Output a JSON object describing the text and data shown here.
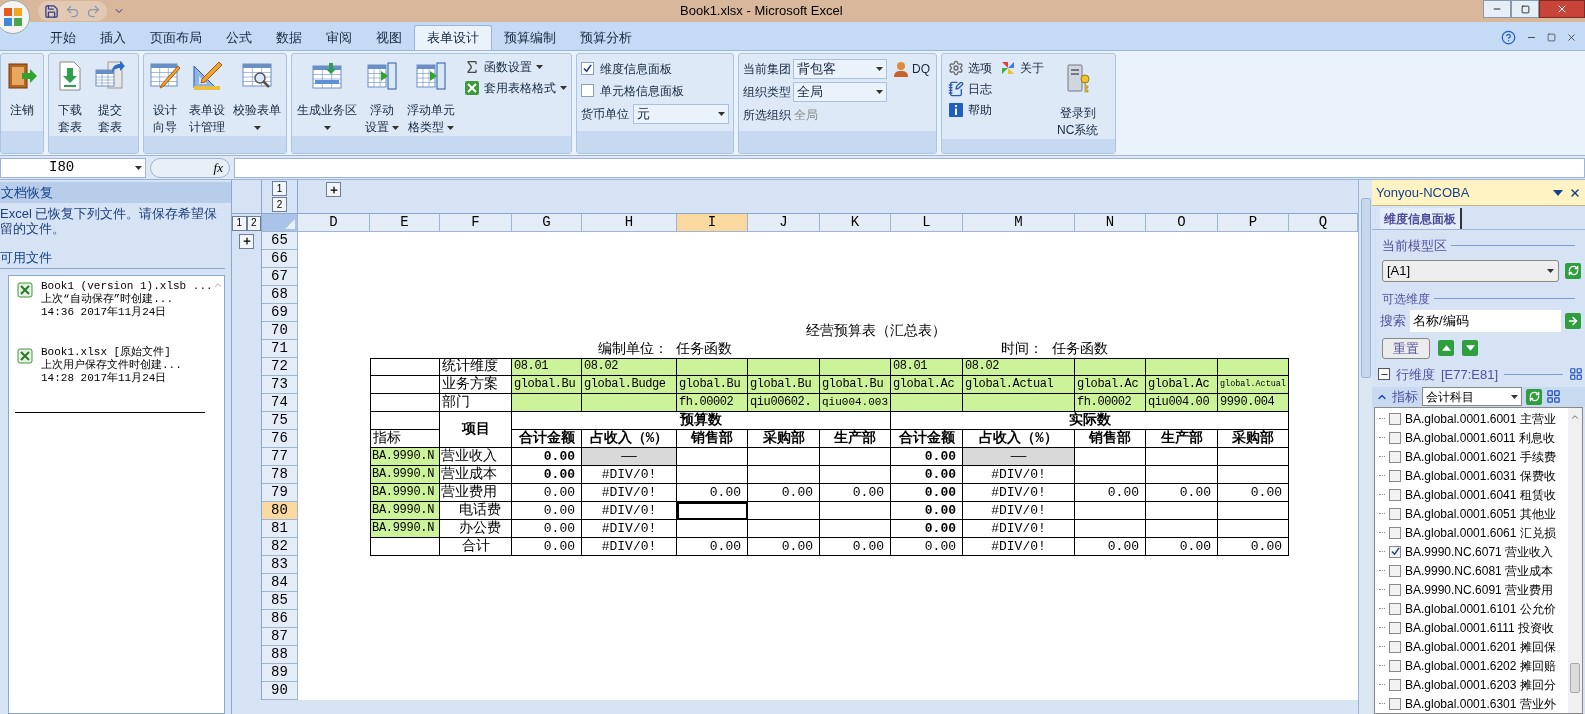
{
  "window": {
    "title": "Book1.xlsx - Microsoft Excel"
  },
  "ribbon_tabs": [
    {
      "label": "开始",
      "selected": false
    },
    {
      "label": "插入",
      "selected": false
    },
    {
      "label": "页面布局",
      "selected": false
    },
    {
      "label": "公式",
      "selected": false
    },
    {
      "label": "数据",
      "selected": false
    },
    {
      "label": "审阅",
      "selected": false
    },
    {
      "label": "视图",
      "selected": false
    },
    {
      "label": "表单设计",
      "selected": true
    },
    {
      "label": "预算编制",
      "selected": false
    },
    {
      "label": "预算分析",
      "selected": false
    }
  ],
  "ribbon_groups": [
    {
      "kind": "buttons",
      "buttons": [
        {
          "lines": [
            "注销"
          ],
          "dropdown": false
        }
      ]
    },
    {
      "kind": "buttons",
      "buttons": [
        {
          "lines": [
            "下载",
            "套表"
          ],
          "dropdown": false
        },
        {
          "lines": [
            "提交",
            "套表"
          ],
          "dropdown": false
        }
      ]
    },
    {
      "kind": "buttons",
      "buttons": [
        {
          "lines": [
            "设计",
            "向导"
          ],
          "dropdown": false
        },
        {
          "lines": [
            "表单设",
            "计管理"
          ],
          "dropdown": false
        },
        {
          "lines": [
            "校验表单"
          ],
          "dropdown": true
        }
      ]
    },
    {
      "kind": "buttons",
      "buttons": [
        {
          "lines": [
            "生成业务区"
          ],
          "dropdown": true
        },
        {
          "lines": [
            "浮动",
            "设置"
          ],
          "dropdown": true
        },
        {
          "lines": [
            "浮动单元",
            "格类型"
          ],
          "dropdown": true
        }
      ],
      "small_buttons": [
        {
          "label": "函数设置",
          "dropdown": true
        },
        {
          "label": "套用表格格式",
          "dropdown": true
        }
      ]
    },
    {
      "kind": "panels",
      "toggles": [
        {
          "label": "维度信息面板",
          "checked": true
        },
        {
          "label": "单元格信息面板",
          "checked": false
        }
      ],
      "currency": {
        "label": "货币单位",
        "value": "元"
      }
    },
    {
      "kind": "organization",
      "fields": [
        {
          "label": "当前集团",
          "value": "背包客",
          "kind": "select"
        },
        {
          "label": "组织类型",
          "value": "全局",
          "kind": "select"
        },
        {
          "label": "所选组织",
          "value": "全局",
          "kind": "readonly"
        }
      ],
      "user": "DQ"
    },
    {
      "kind": "system",
      "small_buttons": [
        {
          "label": "选项",
          "dropdown": false
        },
        {
          "label": "关于",
          "dropdown": false
        },
        {
          "label": "日志",
          "dropdown": false
        },
        {
          "label": "帮助",
          "dropdown": false
        }
      ],
      "buttons": [
        {
          "lines": [
            "登录到",
            "NC系统"
          ],
          "dropdown": false
        }
      ]
    }
  ],
  "formula_bar": {
    "name_box": "I80",
    "function_label": "fx"
  },
  "recovery_pane": {
    "title": "文档恢复",
    "message": "Excel 已恢复下列文件。请保存希望保留的文件。",
    "files_heading": "可用文件",
    "files": [
      {
        "name": "Book1 (version 1).xlsb ...",
        "note": "上次“自动保存”时创建...",
        "time": "14:36 2017年11月24日"
      },
      {
        "name": "Book1.xlsx  [原始文件]",
        "note": "上次用户保存文件时创建...",
        "time": "14:28 2017年11月24日"
      }
    ]
  },
  "sheet": {
    "column_outline_levels": [
      "1",
      "2"
    ],
    "row_outline_levels": [
      "1",
      "2"
    ],
    "columns": [
      {
        "label": "D",
        "selected": false
      },
      {
        "label": "E",
        "selected": false
      },
      {
        "label": "F",
        "selected": false
      },
      {
        "label": "G",
        "selected": false
      },
      {
        "label": "H",
        "selected": false
      },
      {
        "label": "I",
        "selected": true
      },
      {
        "label": "J",
        "selected": false
      },
      {
        "label": "K",
        "selected": false
      },
      {
        "label": "L",
        "selected": false
      },
      {
        "label": "M",
        "selected": false
      },
      {
        "label": "N",
        "selected": false
      },
      {
        "label": "O",
        "selected": false
      },
      {
        "label": "P",
        "selected": false
      },
      {
        "label": "Q",
        "selected": false
      }
    ],
    "rows": [
      {
        "label": "65",
        "selected": false
      },
      {
        "label": "66",
        "selected": false
      },
      {
        "label": "67",
        "selected": false
      },
      {
        "label": "68",
        "selected": false
      },
      {
        "label": "69",
        "selected": false
      },
      {
        "label": "70",
        "selected": false
      },
      {
        "label": "71",
        "selected": false
      },
      {
        "label": "72",
        "selected": false
      },
      {
        "label": "73",
        "selected": false
      },
      {
        "label": "74",
        "selected": false
      },
      {
        "label": "75",
        "selected": false
      },
      {
        "label": "76",
        "selected": false
      },
      {
        "label": "77",
        "selected": false
      },
      {
        "label": "78",
        "selected": false
      },
      {
        "label": "79",
        "selected": false
      },
      {
        "label": "80",
        "selected": true
      },
      {
        "label": "81",
        "selected": false
      },
      {
        "label": "82",
        "selected": false
      },
      {
        "label": "83",
        "selected": false
      },
      {
        "label": "84",
        "selected": false
      },
      {
        "label": "85",
        "selected": false
      },
      {
        "label": "86",
        "selected": false
      },
      {
        "label": "87",
        "selected": false
      },
      {
        "label": "88",
        "selected": false
      },
      {
        "label": "89",
        "selected": false
      },
      {
        "label": "90",
        "selected": false
      }
    ],
    "report": {
      "title": "经营预算表（汇总表）",
      "unit_caption": "编制单位： 任务函数",
      "time_caption": "时间： 任务函数",
      "dimension_rows": [
        {
          "label": "统计维度",
          "cells": [
            {
              "text": "08.01"
            },
            {
              "text": "08.02"
            },
            {},
            {},
            {},
            {
              "text": "08.01"
            },
            {
              "text": "08.02"
            },
            {},
            {},
            {}
          ]
        },
        {
          "label": "业务方案",
          "cells": [
            {
              "text": "global.Bu"
            },
            {
              "text": "global.Budge"
            },
            {
              "text": "global.Bu"
            },
            {
              "text": "global.Bu"
            },
            {
              "text": "global.Bu"
            },
            {
              "text": "global.Ac"
            },
            {
              "text": "global.Actual"
            },
            {
              "text": "global.Ac"
            },
            {
              "text": "global.Ac"
            },
            {
              "text": "global.Actual"
            }
          ]
        },
        {
          "label": "部门",
          "cells": [
            {},
            {},
            {
              "text": "fh.00002"
            },
            {
              "text": "qiu00602."
            },
            {
              "text": "qiu004.003"
            },
            {},
            {},
            {
              "text": "fh.00002"
            },
            {
              "text": "qiu004.00"
            },
            {
              "text": "9990.004"
            }
          ]
        }
      ],
      "index_heading": "指标",
      "item_heading": "项目",
      "groups": [
        {
          "title": "预算数",
          "columns": [
            "合计金额",
            "占收入（%）",
            "销售部",
            "采购部",
            "生产部"
          ]
        },
        {
          "title": "实际数",
          "columns": [
            "合计金额",
            "占收入（%）",
            "销售部",
            "生产部",
            "采购部"
          ]
        }
      ],
      "rows": [
        {
          "index": "BA.9990.N",
          "label": "营业收入",
          "kind": "item",
          "cells": [
            {
              "text": "0.00",
              "kind": "amount-bold"
            },
            {
              "text": "——",
              "kind": "dash"
            },
            {
              "kind": "empty"
            },
            {
              "kind": "empty"
            },
            {
              "kind": "empty"
            },
            {
              "text": "0.00",
              "kind": "amount-bold"
            },
            {
              "text": "——",
              "kind": "dash"
            },
            {
              "kind": "empty"
            },
            {
              "kind": "empty"
            },
            {
              "kind": "empty"
            }
          ]
        },
        {
          "index": "BA.9990.N",
          "label": "营业成本",
          "kind": "item",
          "cells": [
            {
              "text": "0.00",
              "kind": "amount-bold"
            },
            {
              "text": "#DIV/0!",
              "kind": "percent"
            },
            {
              "kind": "empty"
            },
            {
              "kind": "empty"
            },
            {
              "kind": "empty"
            },
            {
              "text": "0.00",
              "kind": "amount-bold"
            },
            {
              "text": "#DIV/0!",
              "kind": "percent"
            },
            {
              "kind": "empty"
            },
            {
              "kind": "empty"
            },
            {
              "kind": "empty"
            }
          ]
        },
        {
          "index": "BA.9990.N",
          "label": "营业费用",
          "kind": "item",
          "cells": [
            {
              "text": "0.00",
              "kind": "amount"
            },
            {
              "text": "#DIV/0!",
              "kind": "percent"
            },
            {
              "text": "0.00",
              "kind": "amount"
            },
            {
              "text": "0.00",
              "kind": "amount"
            },
            {
              "text": "0.00",
              "kind": "amount"
            },
            {
              "text": "0.00",
              "kind": "amount-bold"
            },
            {
              "text": "#DIV/0!",
              "kind": "percent"
            },
            {
              "text": "0.00",
              "kind": "amount"
            },
            {
              "text": "0.00",
              "kind": "amount"
            },
            {
              "text": "0.00",
              "kind": "amount"
            }
          ]
        },
        {
          "index": "BA.9990.N",
          "label": "电话费",
          "kind": "sub-item",
          "cells": [
            {
              "text": "0.00",
              "kind": "amount"
            },
            {
              "text": "#DIV/0!",
              "kind": "percent"
            },
            {
              "kind": "empty"
            },
            {
              "kind": "empty"
            },
            {
              "kind": "empty"
            },
            {
              "text": "0.00",
              "kind": "amount-bold"
            },
            {
              "text": "#DIV/0!",
              "kind": "percent"
            },
            {
              "kind": "empty"
            },
            {
              "kind": "empty"
            },
            {
              "kind": "empty"
            }
          ]
        },
        {
          "index": "BA.9990.N",
          "label": "办公费",
          "kind": "sub-item",
          "cells": [
            {
              "text": "0.00",
              "kind": "amount"
            },
            {
              "text": "#DIV/0!",
              "kind": "percent"
            },
            {
              "kind": "empty"
            },
            {
              "kind": "empty"
            },
            {
              "kind": "empty"
            },
            {
              "text": "0.00",
              "kind": "amount-bold"
            },
            {
              "text": "#DIV/0!",
              "kind": "percent"
            },
            {
              "kind": "empty"
            },
            {
              "kind": "empty"
            },
            {
              "kind": "empty"
            }
          ]
        },
        {
          "label": "合计",
          "kind": "total",
          "cells": [
            {
              "text": "0.00",
              "kind": "amount"
            },
            {
              "text": "#DIV/0!",
              "kind": "percent"
            },
            {
              "text": "0.00",
              "kind": "amount"
            },
            {
              "text": "0.00",
              "kind": "amount"
            },
            {
              "text": "0.00",
              "kind": "amount"
            },
            {
              "text": "0.00",
              "kind": "amount"
            },
            {
              "text": "#DIV/0!",
              "kind": "percent"
            },
            {
              "text": "0.00",
              "kind": "amount"
            },
            {
              "text": "0.00",
              "kind": "amount"
            },
            {
              "text": "0.00",
              "kind": "amount"
            }
          ]
        }
      ]
    }
  },
  "side_panel": {
    "title": "Yonyou-NCOBA",
    "tabs": [
      {
        "label": "维度信息面板",
        "selected": true
      }
    ],
    "model_area_label": "当前模型区",
    "model_area": "[A1]",
    "optional_label": "可选维度",
    "search_label": "搜索",
    "search_value": "名称/编码",
    "reset": "重置",
    "row_dimension": {
      "label": "行维度",
      "range": "[E77:E81]",
      "expanded": true
    },
    "index": {
      "label": "指标",
      "value": "会计科目",
      "expanded": true
    },
    "items": [
      {
        "label": "BA.global.0001.6001 主营业",
        "checked": false
      },
      {
        "label": "BA.global.0001.6011 利息收",
        "checked": false
      },
      {
        "label": "BA.global.0001.6021 手续费",
        "checked": false
      },
      {
        "label": "BA.global.0001.6031 保费收",
        "checked": false
      },
      {
        "label": "BA.global.0001.6041 租赁收",
        "checked": false
      },
      {
        "label": "BA.global.0001.6051 其他业",
        "checked": false
      },
      {
        "label": "BA.global.0001.6061 汇兑损",
        "checked": false
      },
      {
        "label": "BA.9990.NC.6071 营业收入",
        "checked": true
      },
      {
        "label": "BA.9990.NC.6081 营业成本",
        "checked": false
      },
      {
        "label": "BA.9990.NC.6091 营业费用",
        "checked": false
      },
      {
        "label": "BA.global.0001.6101 公允价",
        "checked": false
      },
      {
        "label": "BA.global.0001.6111 投资收",
        "checked": false
      },
      {
        "label": "BA.global.0001.6201 摊回保",
        "checked": false
      },
      {
        "label": "BA.global.0001.6202 摊回赔",
        "checked": false
      },
      {
        "label": "BA.global.0001.6203 摊回分",
        "checked": false
      },
      {
        "label": "BA.global.0001.6301 营业外",
        "checked": false
      }
    ]
  }
}
